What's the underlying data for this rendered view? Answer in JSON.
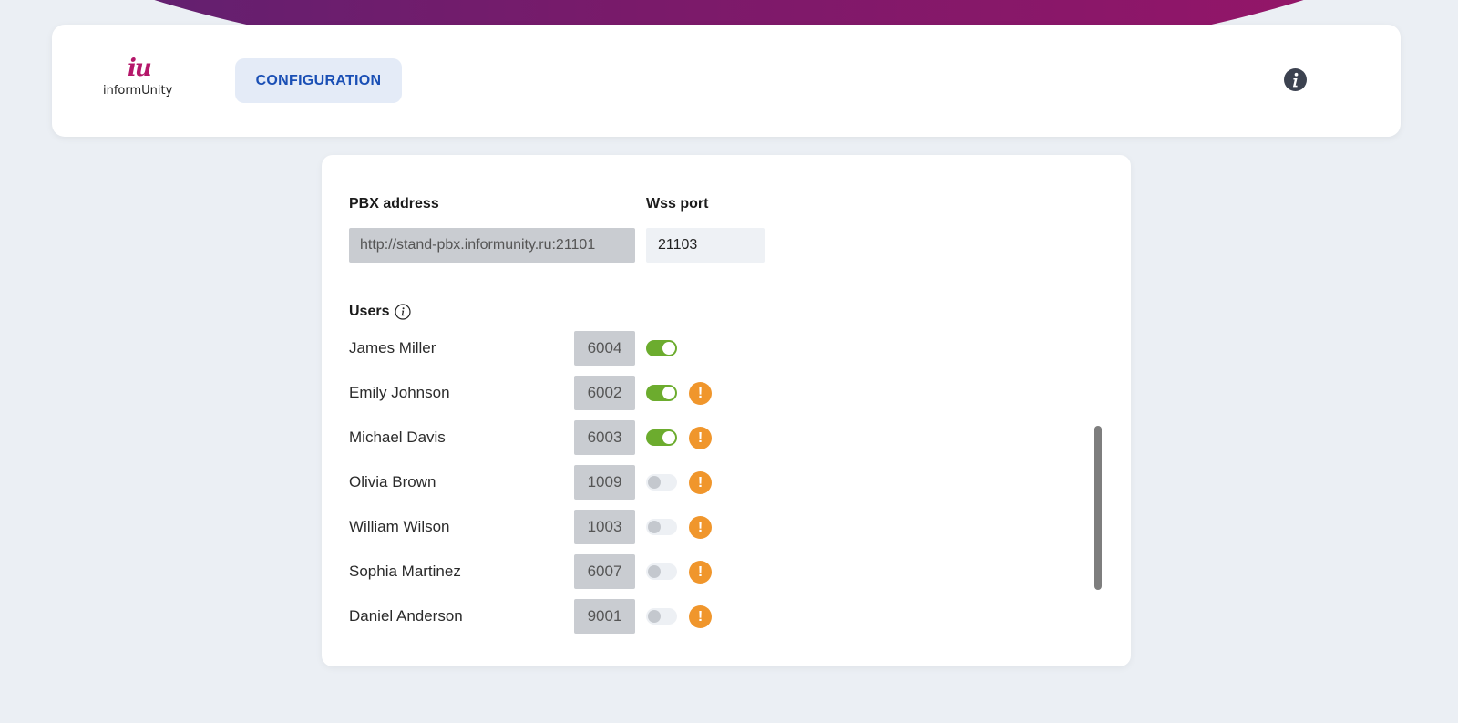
{
  "header": {
    "logo_mark": "iu",
    "logo_text": "informUnity",
    "config_label": "CONFIGURATION",
    "info_icon": "info-circle-icon"
  },
  "settings": {
    "pbx_label": "PBX address",
    "pbx_value": "http://stand-pbx.informunity.ru:21101",
    "wss_label": "Wss port",
    "wss_value": "21103"
  },
  "users": {
    "title": "Users",
    "items": [
      {
        "name": "James Miller",
        "ext": "6004",
        "enabled": true,
        "warning": false
      },
      {
        "name": "Emily Johnson",
        "ext": "6002",
        "enabled": true,
        "warning": true
      },
      {
        "name": "Michael Davis",
        "ext": "6003",
        "enabled": true,
        "warning": true
      },
      {
        "name": "Olivia Brown",
        "ext": "1009",
        "enabled": false,
        "warning": true
      },
      {
        "name": "William Wilson",
        "ext": "1003",
        "enabled": false,
        "warning": true
      },
      {
        "name": "Sophia Martinez",
        "ext": "6007",
        "enabled": false,
        "warning": true
      },
      {
        "name": "Daniel Anderson",
        "ext": "9001",
        "enabled": false,
        "warning": true
      }
    ]
  },
  "colors": {
    "accent": "#1a4fb5",
    "toggle_on": "#6cac2e",
    "warning": "#f0962c",
    "brand": "#b5176a"
  }
}
